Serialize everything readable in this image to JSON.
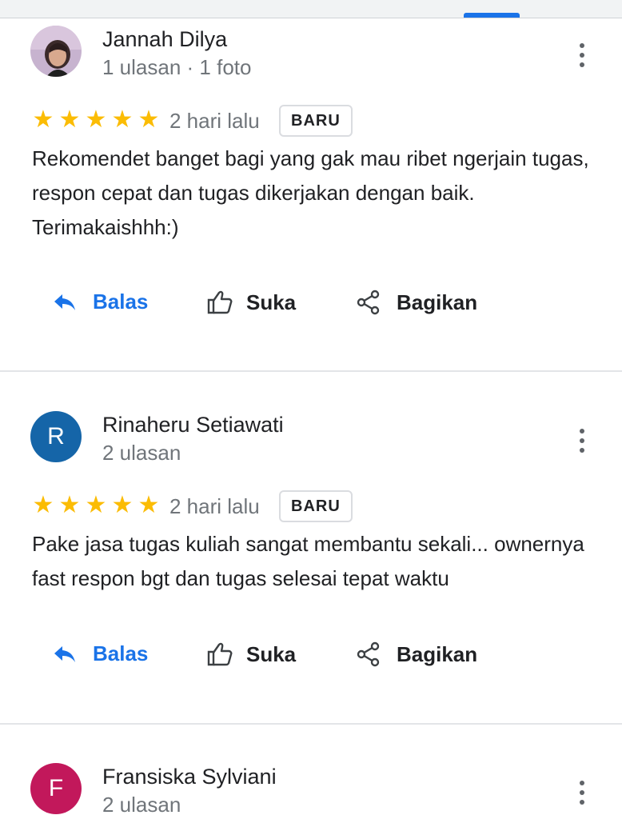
{
  "reviews": [
    {
      "author": "Jannah Dilya",
      "meta": "1 ulasan · 1 foto",
      "avatar_letter": "",
      "avatar_color": "#7a5a6e",
      "rating": 5,
      "date": "2 hari lalu",
      "badge": "BARU",
      "text": "Rekomendet banget bagi yang gak mau ribet ngerjain tugas, respon cepat dan tugas dikerjakan dengan baik. Terimakaishhh:)",
      "actions": {
        "reply": "Balas",
        "like": "Suka",
        "share": "Bagikan"
      }
    },
    {
      "author": "Rinaheru Setiawati",
      "meta": "2 ulasan",
      "avatar_letter": "R",
      "avatar_color": "#1565a8",
      "rating": 5,
      "date": "2 hari lalu",
      "badge": "BARU",
      "text": "Pake jasa tugas kuliah sangat membantu sekali... ownernya fast respon bgt dan tugas selesai tepat waktu",
      "actions": {
        "reply": "Balas",
        "like": "Suka",
        "share": "Bagikan"
      }
    },
    {
      "author": "Fransiska Sylviani",
      "meta": "2 ulasan",
      "avatar_letter": "F",
      "avatar_color": "#c2185b"
    }
  ],
  "colors": {
    "star": "#fbbc04",
    "accent": "#1a73e8",
    "divider": "#e3e5e8"
  },
  "icons": [
    "reply-arrow-icon",
    "thumbs-up-icon",
    "share-icon",
    "more-vert-icon",
    "star-icon"
  ]
}
